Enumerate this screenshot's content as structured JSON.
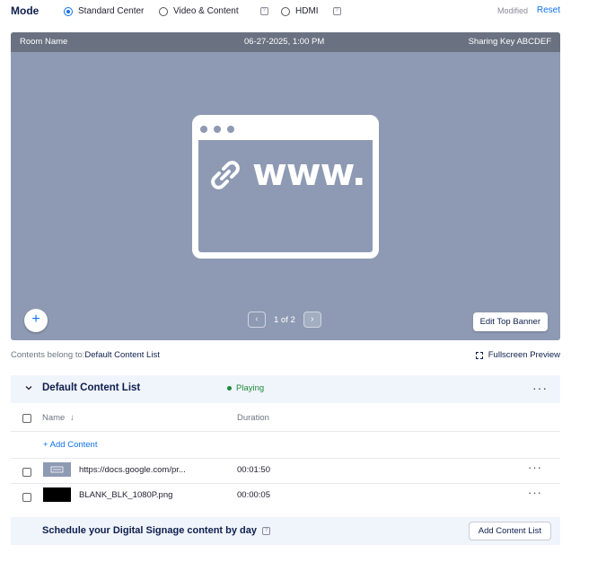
{
  "mode": {
    "label": "Mode",
    "options": [
      {
        "label": "Standard Center",
        "selected": true
      },
      {
        "label": "Video & Content",
        "selected": false
      },
      {
        "label": "HDMI",
        "selected": false
      }
    ],
    "modified_label": "Modified",
    "reset_label": "Reset"
  },
  "preview": {
    "banner": {
      "room_name": "Room Name",
      "datetime": "06-27-2025, 1:00 PM",
      "sharing_key": "Sharing Key ABCDEF"
    },
    "graphic_text": "www.",
    "add_icon": "+",
    "pager": {
      "prev_icon": "‹",
      "count": "1 of 2",
      "next_icon": "›"
    },
    "edit_banner_label": "Edit Top Banner",
    "background_color": "#8e9ab3"
  },
  "contents_belong": {
    "label": "Contents belong to:",
    "value": "Default Content List",
    "fullscreen_label": "Fullscreen Preview"
  },
  "content_list": {
    "title": "Default Content List",
    "status": "Playing",
    "more_icon": "···",
    "columns": {
      "name": "Name",
      "sort_icon": "↓",
      "duration": "Duration"
    },
    "add_content_label": "+  Add Content",
    "items": [
      {
        "name": "https://docs.google.com/pr...",
        "duration": "00:01:50",
        "thumb": "web-thumbnail"
      },
      {
        "name": "BLANK_BLK_1080P.png",
        "duration": "00:00:05",
        "thumb": "black-image-thumbnail"
      }
    ]
  },
  "schedule": {
    "text": "Schedule your Digital Signage content by day",
    "button_label": "Add Content List"
  },
  "colors": {
    "accent": "#0e72ed",
    "playing": "#1d8b3a",
    "banner": "#6a7281"
  }
}
